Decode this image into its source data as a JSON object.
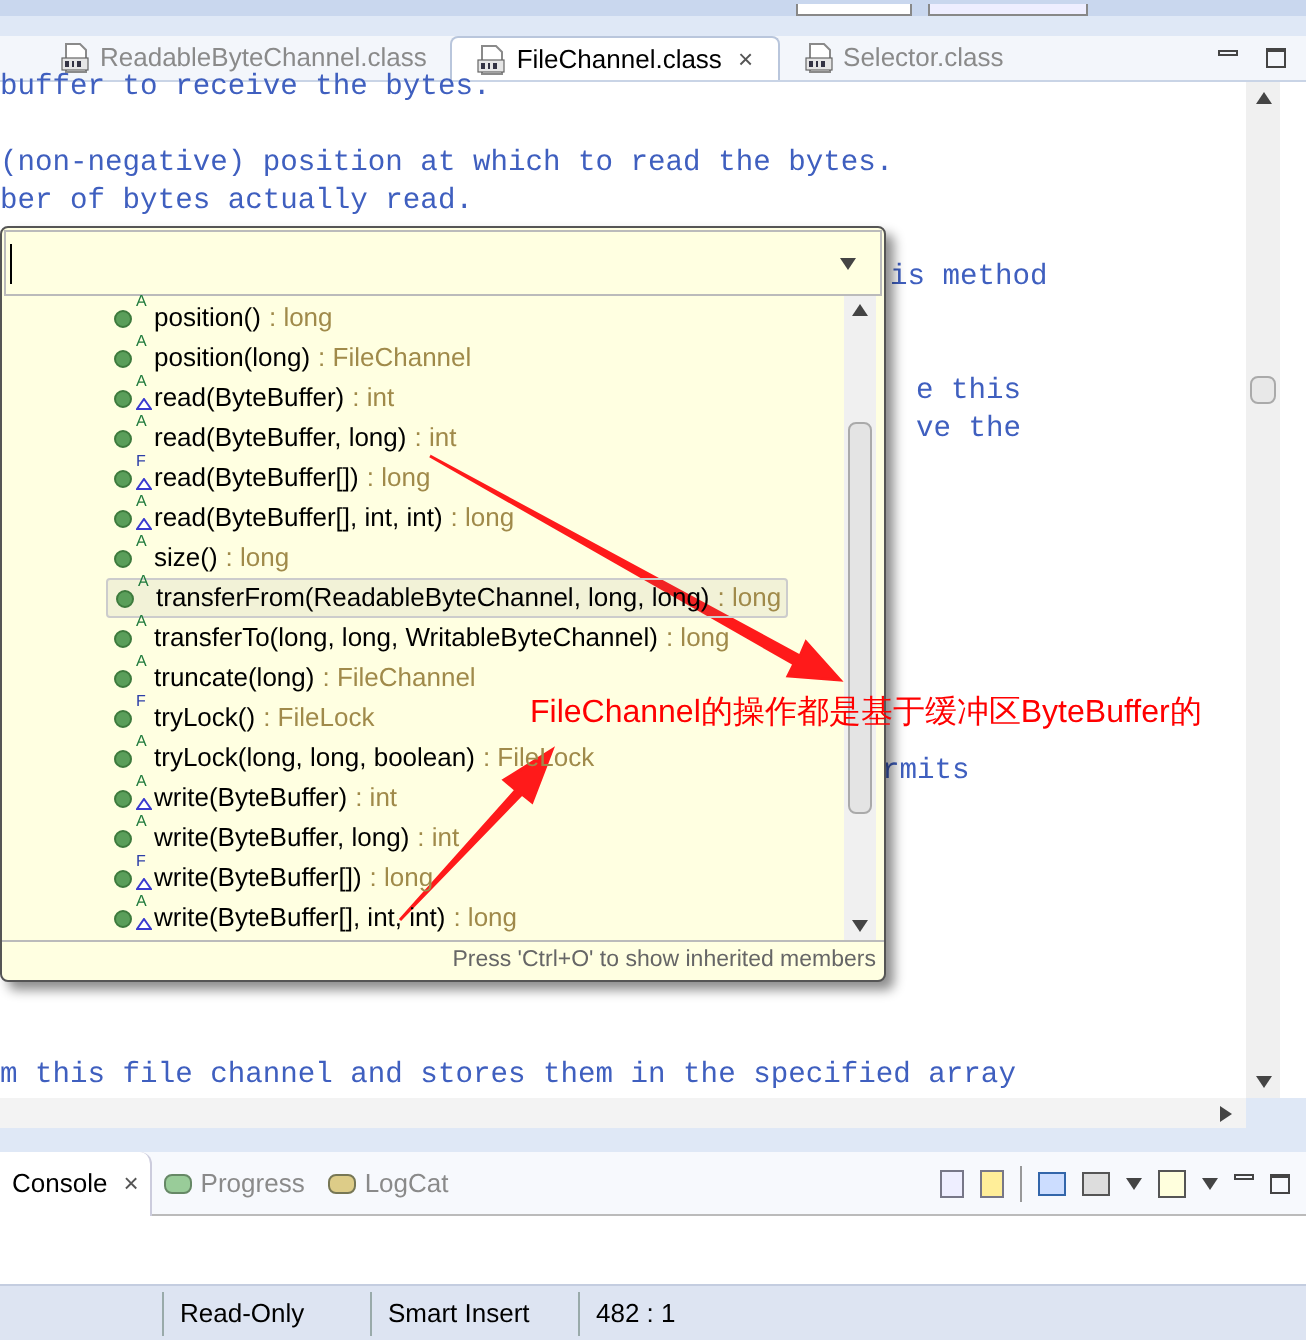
{
  "editor_tabs": [
    {
      "label": "ReadableByteChannel.class",
      "selected": false
    },
    {
      "label": "FileChannel.class",
      "selected": true,
      "close": "×"
    },
    {
      "label": "Selector.class",
      "selected": false
    }
  ],
  "code_lines": [
    {
      "text": "buffer to receive the bytes."
    },
    {
      "text": "(non-negative) position at which to read the bytes."
    },
    {
      "text": "ber of bytes actually read."
    },
    {
      "text": "is method"
    },
    {
      "text": "e this"
    },
    {
      "text": "ve the"
    },
    {
      "text": "rmits"
    },
    {
      "text": "m this file channel and stores them in the specified array"
    }
  ],
  "outline_popup": {
    "items": [
      {
        "name": "position()",
        "type": ": long",
        "modifier": "A",
        "overrides": false,
        "selected": false
      },
      {
        "name": "position(long)",
        "type": ": FileChannel",
        "modifier": "A",
        "overrides": false,
        "selected": false
      },
      {
        "name": "read(ByteBuffer)",
        "type": ": int",
        "modifier": "A",
        "overrides": true,
        "selected": false
      },
      {
        "name": "read(ByteBuffer, long)",
        "type": ": int",
        "modifier": "A",
        "overrides": false,
        "selected": false
      },
      {
        "name": "read(ByteBuffer[])",
        "type": ": long",
        "modifier": "F",
        "overrides": true,
        "selected": false
      },
      {
        "name": "read(ByteBuffer[], int, int)",
        "type": ": long",
        "modifier": "A",
        "overrides": true,
        "selected": false
      },
      {
        "name": "size()",
        "type": ": long",
        "modifier": "A",
        "overrides": false,
        "selected": false
      },
      {
        "name": "transferFrom(ReadableByteChannel, long, long)",
        "type": ": long",
        "modifier": "A",
        "overrides": false,
        "selected": true
      },
      {
        "name": "transferTo(long, long, WritableByteChannel)",
        "type": ": long",
        "modifier": "A",
        "overrides": false,
        "selected": false
      },
      {
        "name": "truncate(long)",
        "type": ": FileChannel",
        "modifier": "A",
        "overrides": false,
        "selected": false
      },
      {
        "name": "tryLock()",
        "type": ": FileLock",
        "modifier": "F",
        "overrides": false,
        "selected": false
      },
      {
        "name": "tryLock(long, long, boolean)",
        "type": ": FileLock",
        "modifier": "A",
        "overrides": false,
        "selected": false
      },
      {
        "name": "write(ByteBuffer)",
        "type": ": int",
        "modifier": "A",
        "overrides": true,
        "selected": false
      },
      {
        "name": "write(ByteBuffer, long)",
        "type": ": int",
        "modifier": "A",
        "overrides": false,
        "selected": false
      },
      {
        "name": "write(ByteBuffer[])",
        "type": ": long",
        "modifier": "F",
        "overrides": true,
        "selected": false
      },
      {
        "name": "write(ByteBuffer[], int, int)",
        "type": ": long",
        "modifier": "A",
        "overrides": true,
        "selected": false
      }
    ],
    "footer": "Press 'Ctrl+O' to show inherited members"
  },
  "annotation": {
    "text": "FileChannel的操作都是基于缓冲区ByteBuffer的"
  },
  "bottom_tabs": [
    {
      "label": "Console",
      "selected": true,
      "close": "×"
    },
    {
      "label": "Progress",
      "selected": false
    },
    {
      "label": "LogCat",
      "selected": false
    }
  ],
  "status_bar": [
    {
      "text": "Read-Only"
    },
    {
      "text": "Smart Insert"
    },
    {
      "text": "482 : 1"
    }
  ]
}
